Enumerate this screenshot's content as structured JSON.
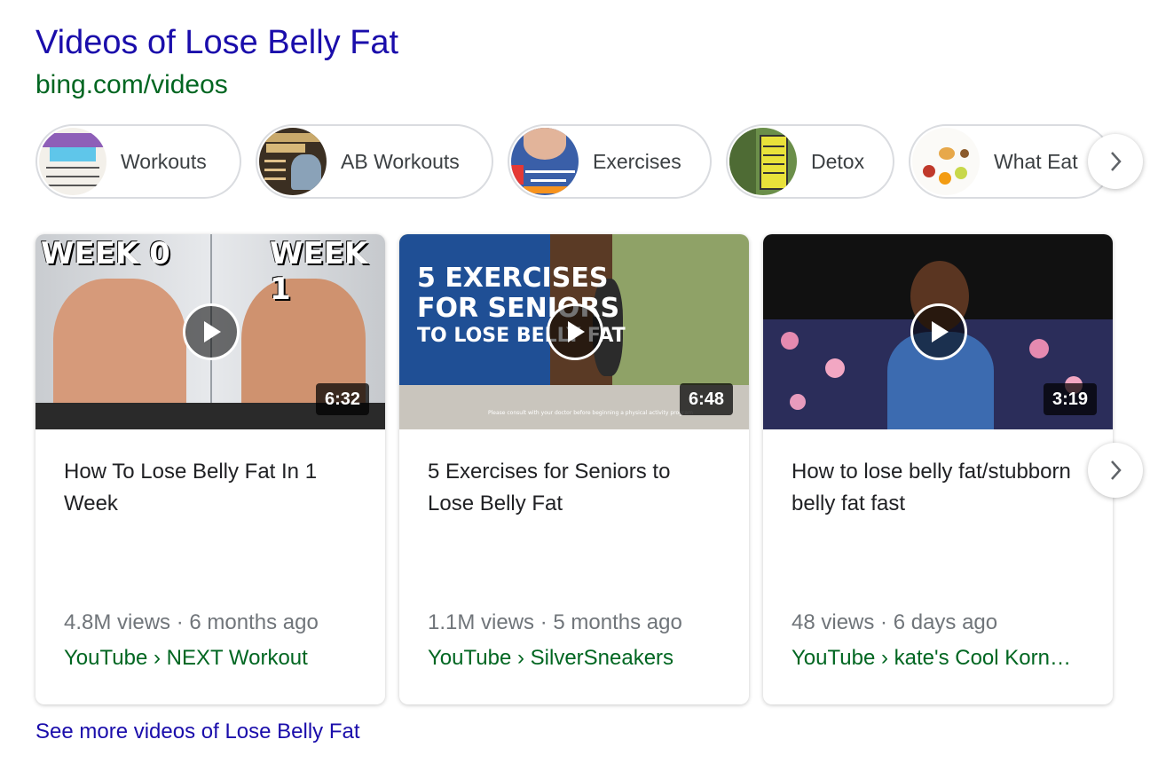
{
  "header": {
    "title": "Videos of Lose Belly Fat",
    "source": "bing.com/videos"
  },
  "chips": [
    {
      "label": "Workouts",
      "thumb_text": "EXERCISES FOR BELLY FAT"
    },
    {
      "label": "AB Workouts",
      "thumb_text": "ULTIMATE AB Workout"
    },
    {
      "label": "Exercises",
      "thumb_text": "12 Best Exercises to Lose Belly"
    },
    {
      "label": "Detox",
      "thumb_text": "DETOX WATER TO LOSE BELLY FAT NATURALLY"
    },
    {
      "label": "What Eat",
      "thumb_text": ""
    }
  ],
  "videos": [
    {
      "title": "How To Lose Belly Fat In 1 Week",
      "duration": "6:32",
      "meta": "4.8M views · 6 months ago",
      "source": "YouTube › NEXT Workout",
      "overlay_left": "WEEK 0",
      "overlay_right": "WEEK 1"
    },
    {
      "title": "5 Exercises for Seniors to Lose Belly Fat",
      "duration": "6:48",
      "meta": "1.1M views · 5 months ago",
      "source": "YouTube › SilverSneakers",
      "overlay_lines": [
        "5 EXERCISES",
        "FOR SENIORS",
        "TO LOSE BELLY FAT"
      ],
      "overlay_small": "Please consult with your doctor before beginning a physical activity program"
    },
    {
      "title": "How to lose belly fat/stubborn belly fat fast",
      "duration": "3:19",
      "meta": "48 views · 6 days ago",
      "source": "YouTube › kate's Cool Korn…"
    }
  ],
  "footer": {
    "see_more": "See more videos of Lose Belly Fat"
  },
  "icons": {
    "next": "chevron-right-icon",
    "play": "play-icon"
  },
  "colors": {
    "title_link": "#1a0dab",
    "source_green": "#006621",
    "meta_gray": "#70757a"
  }
}
